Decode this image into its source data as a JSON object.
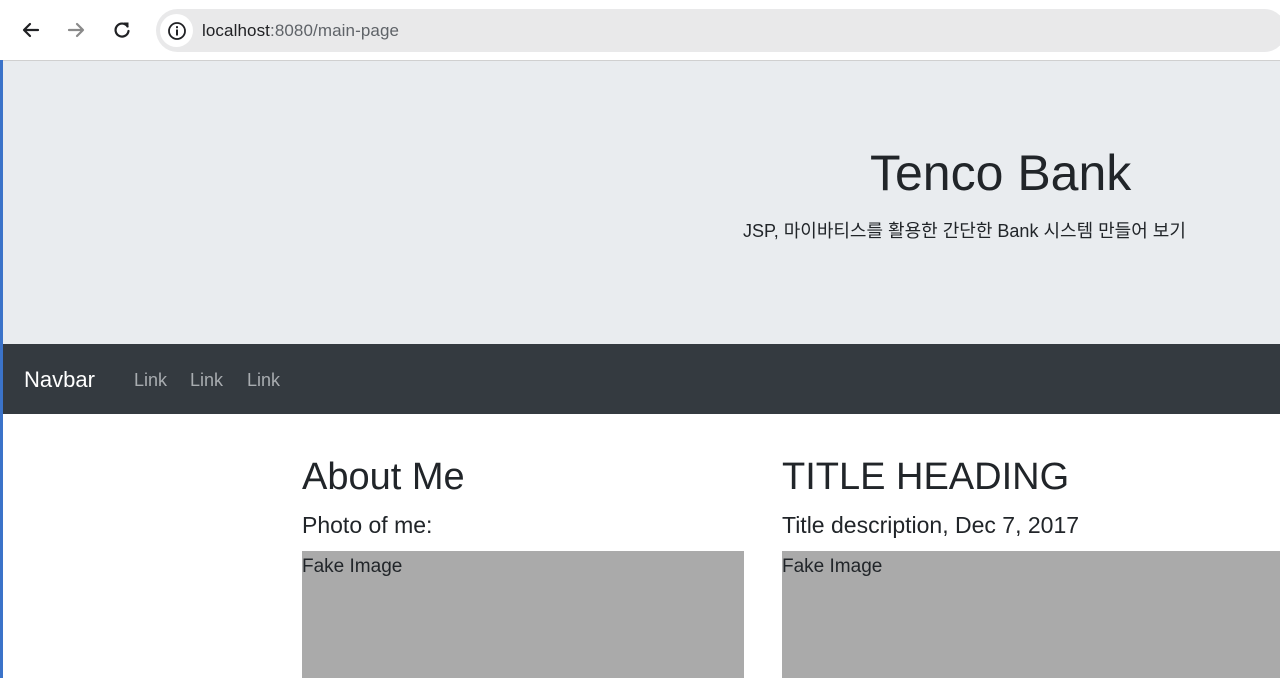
{
  "browser": {
    "url_host": "localhost",
    "url_rest": ":8080/main-page",
    "icons": {
      "back": "back-arrow-icon",
      "forward": "forward-arrow-icon",
      "reload": "reload-icon",
      "info": "info-icon"
    }
  },
  "jumbotron": {
    "title": "Tenco Bank",
    "subtitle": "JSP, 마이바티스를 활용한 간단한 Bank 시스템 만들어 보기"
  },
  "navbar": {
    "brand": "Navbar",
    "links": [
      "Link",
      "Link",
      "Link"
    ]
  },
  "columns": [
    {
      "heading": "About Me",
      "subheading": "Photo of me:",
      "image_label": "Fake Image"
    },
    {
      "heading": "TITLE HEADING",
      "subheading": "Title description, Dec 7, 2017",
      "image_label": "Fake Image"
    }
  ],
  "colors": {
    "jumbotron_bg": "#e9ecef",
    "navbar_bg": "#343a40",
    "fake_image_bg": "#aaaaaa",
    "text": "#212529"
  }
}
